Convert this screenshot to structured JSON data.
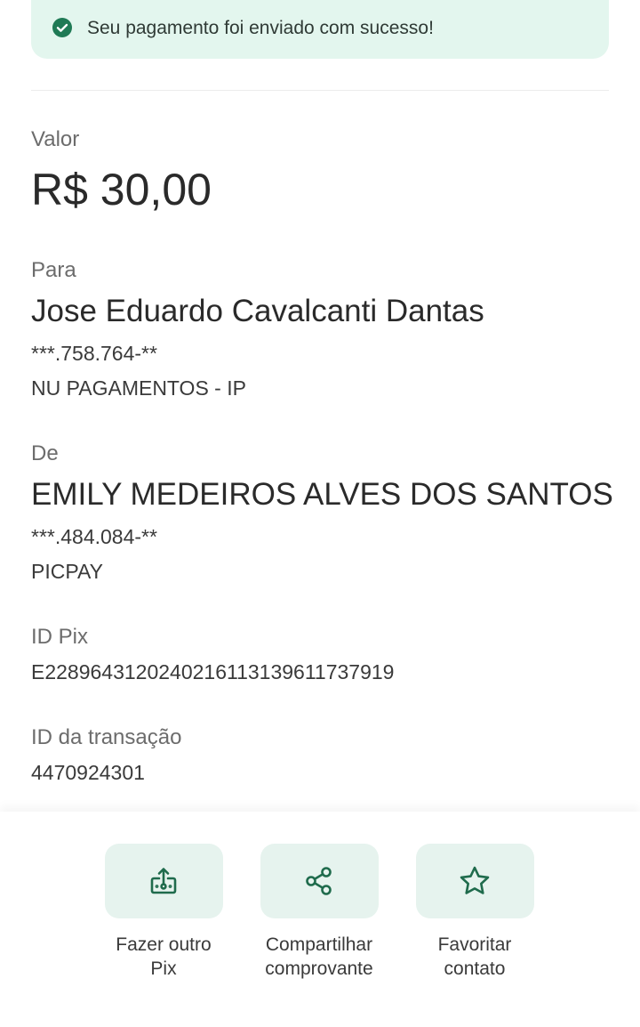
{
  "banner": {
    "message": "Seu pagamento foi enviado com sucesso!",
    "icon": "check-circle-icon",
    "background": "#e3f6ee",
    "accent": "#1f7a55"
  },
  "amount": {
    "label": "Valor",
    "value": "R$ 30,00"
  },
  "recipient": {
    "label": "Para",
    "name": "Jose Eduardo Cavalcanti Dantas",
    "document": "***.758.764-**",
    "institution": "NU PAGAMENTOS - IP"
  },
  "sender": {
    "label": "De",
    "name": "EMILY MEDEIROS ALVES DOS SANTOS",
    "document": "***.484.084-**",
    "institution": "PICPAY"
  },
  "pix_id": {
    "label": "ID Pix",
    "value": "E22896431202402161131396117379​19"
  },
  "transaction_id": {
    "label": "ID da transação",
    "value": "4470924301"
  },
  "actions": [
    {
      "icon": "send-money-icon",
      "line1": "Fazer outro",
      "line2": "Pix"
    },
    {
      "icon": "share-icon",
      "line1": "Compartilhar",
      "line2": "comprovante"
    },
    {
      "icon": "star-icon",
      "line1": "Favoritar",
      "line2": "contato"
    }
  ]
}
